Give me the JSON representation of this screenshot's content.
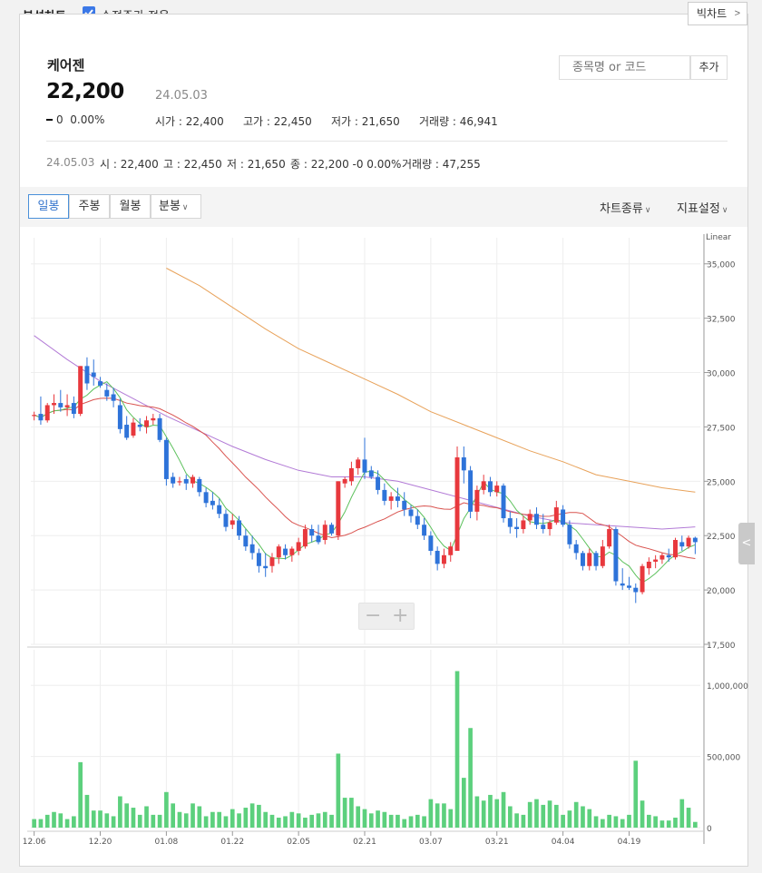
{
  "top": {
    "title": "분석차트",
    "adjusted_label": "수정주가 적용",
    "adjusted_checked": true,
    "big_chart_label": "빅차트"
  },
  "stock": {
    "name": "케어젠",
    "price": "22,200",
    "date": "24.05.03",
    "change": "0",
    "change_rate": "0.00%",
    "open": "시가 : 22,400",
    "high": "고가 : 22,450",
    "low": "저가 : 21,650",
    "volume": "거래량 : 46,941"
  },
  "search": {
    "placeholder": "종목명 or 코드",
    "add_label": "추가"
  },
  "day_info": {
    "date": "24.05.03",
    "open": "시 : 22,400",
    "high": "고 : 22,450",
    "low": "저 : 21,650",
    "close": "종 : 22,200 -0 0.00%",
    "volume": "거래량 : 47,255"
  },
  "tabs": [
    "일봉",
    "주봉",
    "월봉",
    "분봉"
  ],
  "active_tab": "일봉",
  "right_menu": {
    "chart_type": "차트종류",
    "indicator": "지표설정"
  },
  "zoom": {
    "minus": "−",
    "plus": "+"
  },
  "colors": {
    "up": "#e8383d",
    "down": "#2e73d9",
    "ma5": "#5cc15c",
    "ma20": "#d9534f",
    "ma60": "#b27ad6",
    "ma120": "#e8a25a",
    "volume": "#5cd07d"
  },
  "chart_data": {
    "type": "candlestick",
    "scale_label": "Linear",
    "x_ticks": [
      "12.06",
      "12.20",
      "01.08",
      "01.22",
      "02.05",
      "02.21",
      "03.07",
      "03.21",
      "04.04",
      "04.19"
    ],
    "x_tick_index": [
      0,
      10,
      20,
      30,
      40,
      50,
      60,
      70,
      80,
      90
    ],
    "price_ticks": [
      "35,000",
      "32,500",
      "30,000",
      "27,500",
      "25,000",
      "22,500",
      "20,000",
      "17,500"
    ],
    "price_tick_values": [
      35000,
      32500,
      30000,
      27500,
      25000,
      22500,
      20000,
      17500
    ],
    "price_range": [
      17500,
      36200
    ],
    "volume_ticks": [
      "1,000,000",
      "500,000",
      "0"
    ],
    "volume_tick_values": [
      1000000,
      500000,
      0
    ],
    "volume_range": [
      0,
      1250000
    ],
    "candles": [
      [
        28000,
        28200,
        27800,
        28050
      ],
      [
        28100,
        28900,
        27600,
        27800
      ],
      [
        27800,
        28600,
        27700,
        28500
      ],
      [
        28500,
        29000,
        28100,
        28600
      ],
      [
        28600,
        29200,
        28200,
        28400
      ],
      [
        28400,
        29000,
        28000,
        28500
      ],
      [
        28600,
        28900,
        27900,
        28100
      ],
      [
        28100,
        30300,
        28000,
        30300
      ],
      [
        30300,
        30700,
        29200,
        29500
      ],
      [
        30000,
        30600,
        29400,
        29800
      ],
      [
        29600,
        29800,
        29300,
        29400
      ],
      [
        29200,
        29500,
        28700,
        28900
      ],
      [
        29000,
        29300,
        28400,
        28700
      ],
      [
        28500,
        28800,
        27200,
        27400
      ],
      [
        27600,
        28000,
        26900,
        27000
      ],
      [
        27100,
        27900,
        27000,
        27700
      ],
      [
        27600,
        27900,
        27300,
        27500
      ],
      [
        27500,
        28000,
        27200,
        27800
      ],
      [
        27800,
        28100,
        27600,
        27900
      ],
      [
        27900,
        28100,
        26800,
        26900
      ],
      [
        26900,
        27000,
        24800,
        25100
      ],
      [
        25200,
        25400,
        24700,
        24900
      ],
      [
        25000,
        25200,
        24800,
        25000
      ],
      [
        25100,
        25300,
        24600,
        24900
      ],
      [
        24900,
        25300,
        24700,
        25200
      ],
      [
        25100,
        25200,
        24300,
        24500
      ],
      [
        24500,
        24700,
        23800,
        24000
      ],
      [
        24100,
        24500,
        23700,
        23900
      ],
      [
        23900,
        24200,
        23300,
        23500
      ],
      [
        23500,
        23700,
        22700,
        22900
      ],
      [
        23000,
        23500,
        22800,
        23200
      ],
      [
        23200,
        23400,
        22300,
        22500
      ],
      [
        22500,
        22800,
        21800,
        22000
      ],
      [
        22100,
        22500,
        21400,
        21700
      ],
      [
        21700,
        21900,
        20800,
        21100
      ],
      [
        21100,
        21700,
        20600,
        21000
      ],
      [
        21100,
        21700,
        20800,
        21500
      ],
      [
        21500,
        22100,
        21200,
        22000
      ],
      [
        21900,
        22100,
        21400,
        21600
      ],
      [
        21600,
        22000,
        21300,
        21900
      ],
      [
        21800,
        22400,
        21600,
        22200
      ],
      [
        22000,
        23000,
        21900,
        22800
      ],
      [
        22800,
        23000,
        22200,
        22500
      ],
      [
        22500,
        23000,
        22100,
        22200
      ],
      [
        22300,
        23200,
        22100,
        23000
      ],
      [
        23000,
        23100,
        22500,
        22600
      ],
      [
        22500,
        25000,
        22300,
        25000
      ],
      [
        24900,
        25200,
        24700,
        25100
      ],
      [
        25000,
        25900,
        24800,
        25600
      ],
      [
        25600,
        26100,
        25300,
        26000
      ],
      [
        26000,
        27000,
        25100,
        25400
      ],
      [
        25500,
        25700,
        25100,
        25200
      ],
      [
        25200,
        25500,
        24400,
        24600
      ],
      [
        24600,
        24900,
        23900,
        24100
      ],
      [
        24100,
        24500,
        23700,
        24300
      ],
      [
        24300,
        24700,
        23800,
        24100
      ],
      [
        24100,
        24500,
        23400,
        23700
      ],
      [
        23700,
        23900,
        23100,
        23400
      ],
      [
        23400,
        23700,
        22800,
        23000
      ],
      [
        23000,
        23300,
        22300,
        22500
      ],
      [
        22500,
        22700,
        21600,
        21800
      ],
      [
        21800,
        22000,
        20900,
        21200
      ],
      [
        21200,
        21900,
        21000,
        21600
      ],
      [
        21600,
        22200,
        21300,
        22000
      ],
      [
        21800,
        26600,
        21800,
        26100
      ],
      [
        26100,
        26600,
        24900,
        25500
      ],
      [
        25500,
        25700,
        23300,
        23600
      ],
      [
        23600,
        24800,
        23200,
        24600
      ],
      [
        24600,
        25300,
        24400,
        25000
      ],
      [
        25000,
        25200,
        24300,
        24500
      ],
      [
        24500,
        25000,
        24300,
        24800
      ],
      [
        24800,
        24900,
        23100,
        23300
      ],
      [
        23300,
        23600,
        22600,
        22900
      ],
      [
        22900,
        23300,
        22400,
        22800
      ],
      [
        22800,
        23400,
        22600,
        23200
      ],
      [
        23200,
        23700,
        23000,
        23500
      ],
      [
        23500,
        23800,
        22800,
        23000
      ],
      [
        23000,
        23500,
        22600,
        22800
      ],
      [
        22800,
        23200,
        22500,
        23100
      ],
      [
        23100,
        24100,
        23000,
        23800
      ],
      [
        23700,
        23900,
        22900,
        23000
      ],
      [
        23000,
        23200,
        21900,
        22100
      ],
      [
        22100,
        22300,
        21400,
        21700
      ],
      [
        21700,
        21800,
        20900,
        21100
      ],
      [
        21100,
        21900,
        20900,
        21700
      ],
      [
        21700,
        21800,
        20900,
        21100
      ],
      [
        21100,
        22300,
        21000,
        22000
      ],
      [
        22000,
        23000,
        21900,
        22800
      ],
      [
        22800,
        22900,
        20200,
        20400
      ],
      [
        20300,
        21000,
        20000,
        20200
      ],
      [
        20200,
        20600,
        20000,
        20100
      ],
      [
        20100,
        20300,
        19400,
        19900
      ],
      [
        19900,
        21200,
        19800,
        21100
      ],
      [
        21000,
        21500,
        20700,
        21300
      ],
      [
        21300,
        21600,
        21000,
        21400
      ],
      [
        21400,
        21700,
        21200,
        21600
      ],
      [
        21600,
        21900,
        21300,
        21500
      ],
      [
        21500,
        22400,
        21400,
        22300
      ],
      [
        22200,
        22500,
        21800,
        22000
      ],
      [
        22000,
        22500,
        21900,
        22400
      ],
      [
        22400,
        22450,
        21650,
        22200
      ]
    ],
    "volume": [
      60000,
      60000,
      90000,
      110000,
      100000,
      60000,
      80000,
      460000,
      230000,
      120000,
      120000,
      100000,
      80000,
      220000,
      170000,
      140000,
      90000,
      150000,
      90000,
      90000,
      250000,
      170000,
      110000,
      100000,
      170000,
      150000,
      80000,
      110000,
      110000,
      80000,
      130000,
      100000,
      140000,
      170000,
      160000,
      110000,
      90000,
      70000,
      80000,
      110000,
      100000,
      70000,
      90000,
      100000,
      110000,
      90000,
      520000,
      210000,
      210000,
      150000,
      130000,
      100000,
      120000,
      110000,
      90000,
      90000,
      60000,
      80000,
      90000,
      80000,
      200000,
      170000,
      170000,
      130000,
      1100000,
      350000,
      700000,
      220000,
      190000,
      230000,
      200000,
      250000,
      150000,
      100000,
      90000,
      180000,
      200000,
      160000,
      190000,
      160000,
      90000,
      120000,
      180000,
      150000,
      130000,
      80000,
      60000,
      90000,
      80000,
      60000,
      90000,
      470000,
      190000,
      90000,
      80000,
      50000,
      50000,
      70000,
      200000,
      140000,
      40000
    ],
    "ma": [
      {
        "period": 5,
        "color": "#5cc15c"
      },
      {
        "period": 20,
        "color": "#d9534f"
      },
      {
        "period": 60,
        "color": "#b27ad6"
      },
      {
        "period": 120,
        "color": "#e8a25a"
      }
    ],
    "ma120_points": [
      [
        20,
        34800
      ],
      [
        25,
        34000
      ],
      [
        30,
        33000
      ],
      [
        35,
        32000
      ],
      [
        40,
        31100
      ],
      [
        45,
        30400
      ],
      [
        50,
        29700
      ],
      [
        55,
        29000
      ],
      [
        60,
        28200
      ],
      [
        65,
        27600
      ],
      [
        70,
        27000
      ],
      [
        75,
        26400
      ],
      [
        80,
        25900
      ],
      [
        85,
        25300
      ],
      [
        90,
        25000
      ],
      [
        95,
        24700
      ],
      [
        100,
        24500
      ]
    ],
    "ma60_points": [
      [
        0,
        31700
      ],
      [
        5,
        30600
      ],
      [
        10,
        29600
      ],
      [
        15,
        28800
      ],
      [
        20,
        28000
      ],
      [
        25,
        27300
      ],
      [
        30,
        26600
      ],
      [
        35,
        26000
      ],
      [
        40,
        25500
      ],
      [
        45,
        25200
      ],
      [
        50,
        25200
      ],
      [
        55,
        25000
      ],
      [
        60,
        24600
      ],
      [
        65,
        24200
      ],
      [
        70,
        23800
      ],
      [
        75,
        23400
      ],
      [
        80,
        23100
      ],
      [
        85,
        23000
      ],
      [
        90,
        22900
      ],
      [
        95,
        22800
      ],
      [
        100,
        22900
      ]
    ]
  }
}
